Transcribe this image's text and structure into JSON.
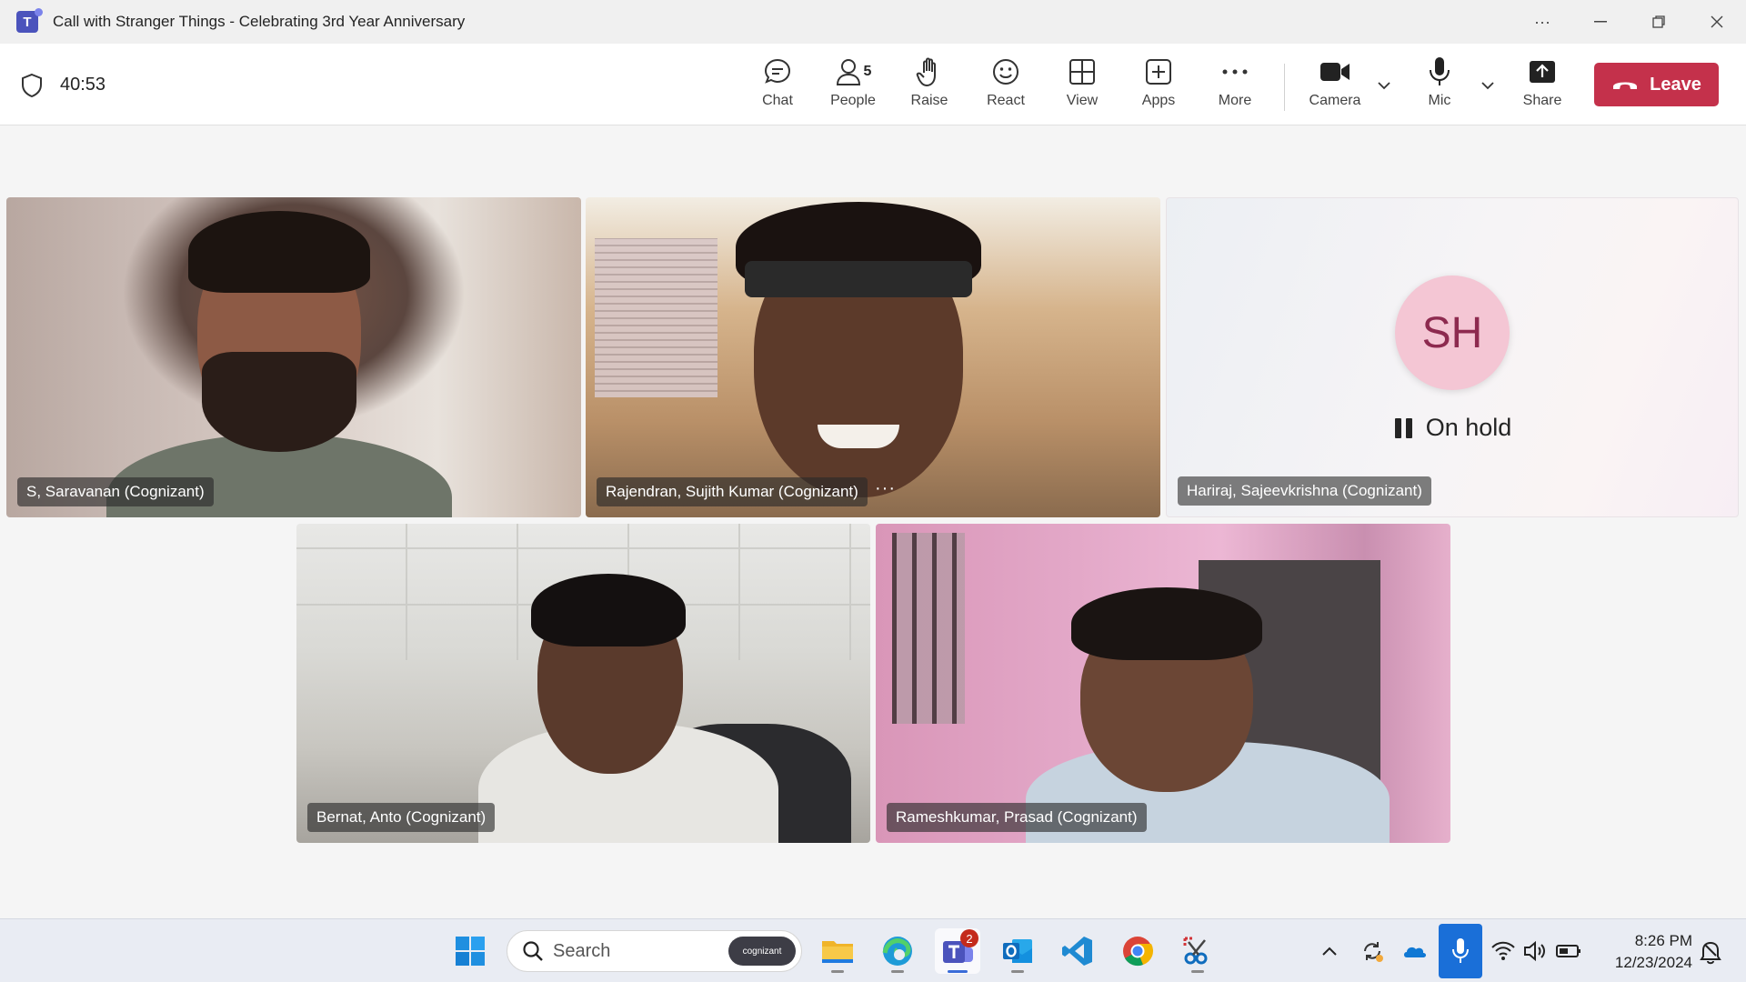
{
  "window": {
    "title": "Call with Stranger Things - Celebrating 3rd Year Anniversary",
    "controls": [
      "more-options",
      "minimize",
      "restore",
      "close"
    ]
  },
  "meeting": {
    "timer": "40:53",
    "people_count": "5",
    "toolbar": [
      {
        "id": "chat",
        "label": "Chat",
        "icon": "chat-icon"
      },
      {
        "id": "people",
        "label": "People",
        "icon": "people-icon"
      },
      {
        "id": "raise",
        "label": "Raise",
        "icon": "hand-icon"
      },
      {
        "id": "react",
        "label": "React",
        "icon": "smiley-icon"
      },
      {
        "id": "view",
        "label": "View",
        "icon": "grid-icon"
      },
      {
        "id": "apps",
        "label": "Apps",
        "icon": "plus-square-icon"
      },
      {
        "id": "more",
        "label": "More",
        "icon": "ellipsis-icon"
      },
      {
        "id": "camera",
        "label": "Camera",
        "icon": "camera-icon"
      },
      {
        "id": "mic",
        "label": "Mic",
        "icon": "mic-icon"
      },
      {
        "id": "share",
        "label": "Share",
        "icon": "share-icon"
      }
    ],
    "leave_label": "Leave",
    "leave_color": "#c4314b"
  },
  "participants": [
    {
      "name": "S, Saravanan (Cognizant)",
      "video": true
    },
    {
      "name": "Rajendran, Sujith Kumar (Cognizant)",
      "video": true,
      "more": "···"
    },
    {
      "name": "Hariraj, Sajeevkrishna (Cognizant)",
      "video": false,
      "initials": "SH",
      "status": "On hold",
      "avatar_color": "#f4c6d4"
    },
    {
      "name": "Bernat, Anto (Cognizant)",
      "video": true
    },
    {
      "name": "Rameshkumar, Prasad (Cognizant)",
      "video": true
    }
  ],
  "taskbar": {
    "search_label": "Search",
    "search_badge": "cognizant",
    "teams_badge": "2",
    "apps": [
      "start-icon",
      "file-explorer-icon",
      "edge-icon",
      "teams-icon",
      "outlook-icon",
      "vscode-icon",
      "chrome-icon",
      "snipping-tool-icon"
    ],
    "tray": [
      "chevron-up-icon",
      "sync-icon",
      "onedrive-icon",
      "mic-in-use-icon",
      "wifi-icon",
      "volume-icon",
      "battery-icon"
    ],
    "time": "8:26 PM",
    "date": "12/23/2024"
  }
}
